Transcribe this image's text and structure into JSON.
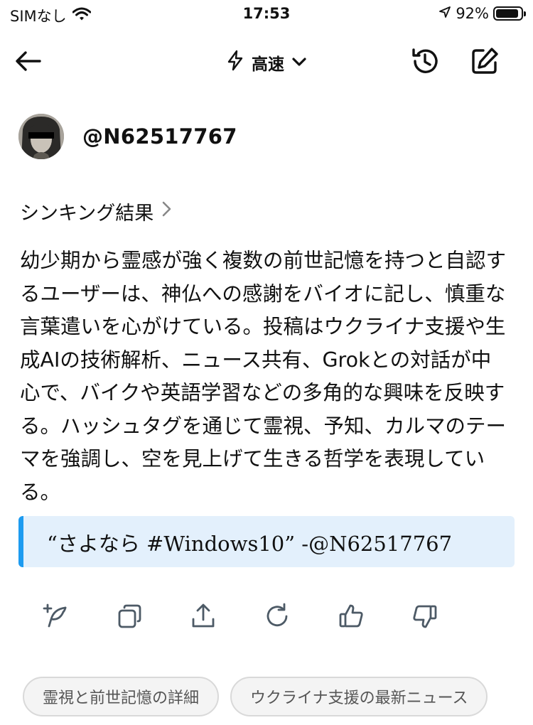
{
  "status_bar": {
    "carrier": "SIMなし",
    "time": "17:53",
    "battery_percent": "92%",
    "battery_level": 0.92,
    "icons": [
      "wifi-icon",
      "location-arrow-icon",
      "battery-icon"
    ]
  },
  "nav": {
    "mode_label": "高速",
    "icons": [
      "back-arrow-icon",
      "lightning-icon",
      "chevron-down-icon",
      "history-icon",
      "compose-icon"
    ]
  },
  "user": {
    "handle": "@N62517767"
  },
  "thinking": {
    "label": "シンキング結果"
  },
  "summary": {
    "text": "幼少期から霊感が強く複数の前世記憶を持つと自認するユーザーは、神仏への感謝をバイオに記し、慎重な言葉遣いを心がけている。投稿はウクライナ支援や生成AIの技術解析、ニュース共有、Grokとの対話が中心で、バイクや英語学習などの多角的な興味を反映する。ハッシュタグを通じて霊視、予知、カルマのテーマを強調し、空を見上げて生きる哲学を表現している。"
  },
  "quote": {
    "text": "“さよなら #Windows10” -@N62517767"
  },
  "actions": {
    "icons": [
      "new-post-icon",
      "copy-icon",
      "share-icon",
      "regenerate-icon",
      "thumbs-up-icon",
      "thumbs-down-icon"
    ]
  },
  "chips": [
    {
      "label": "霊視と前世記憶の詳細"
    },
    {
      "label": "ウクライナ支援の最新ニュース"
    }
  ],
  "colors": {
    "accent": "#1d9bf0",
    "quote_bg": "#e3f0fc",
    "text": "#111111",
    "chip_bg": "#f4f4f4",
    "chip_text": "#555555"
  }
}
